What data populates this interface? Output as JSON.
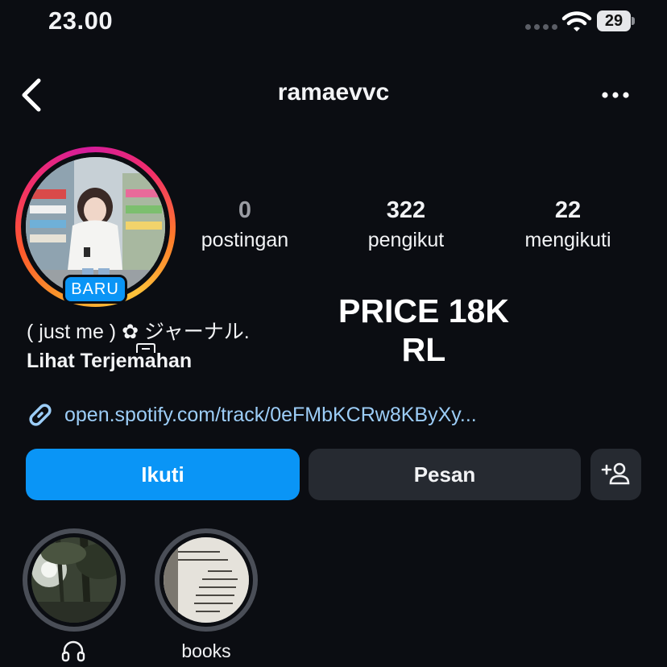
{
  "status_bar": {
    "time": "23.00",
    "battery": "29",
    "icons": [
      "signal-dots-icon",
      "wifi-icon",
      "battery-icon"
    ]
  },
  "header": {
    "username": "ramaevvc",
    "icons": [
      "back-chevron-icon",
      "more-dots-icon"
    ]
  },
  "profile": {
    "avatar_badge": "BARU",
    "story_ring_colors": [
      "#f9a12b",
      "#f22e6a",
      "#d41c9c"
    ],
    "stats": [
      {
        "value": "0",
        "label": "postingan"
      },
      {
        "value": "322",
        "label": "pengikut"
      },
      {
        "value": "22",
        "label": "mengikuti"
      }
    ],
    "bio": "( just me ) ✿ ジャーナル.",
    "translate_label": "Lihat Terjemahan",
    "link": "open.spotify.com/track/0eFMbKCRw8KByXy..."
  },
  "overlay": {
    "price_line1": "PRICE 18K",
    "price_line2": "RL"
  },
  "actions": {
    "follow": "Ikuti",
    "message": "Pesan",
    "add_user_icon": "add-user-icon"
  },
  "highlights": [
    {
      "label_icon": "headphones-icon",
      "label": ""
    },
    {
      "label": "books"
    }
  ],
  "colors": {
    "background": "#0b0d12",
    "accent": "#0a95f6",
    "secondary_button": "#262a31",
    "link": "#9ccdf7"
  }
}
